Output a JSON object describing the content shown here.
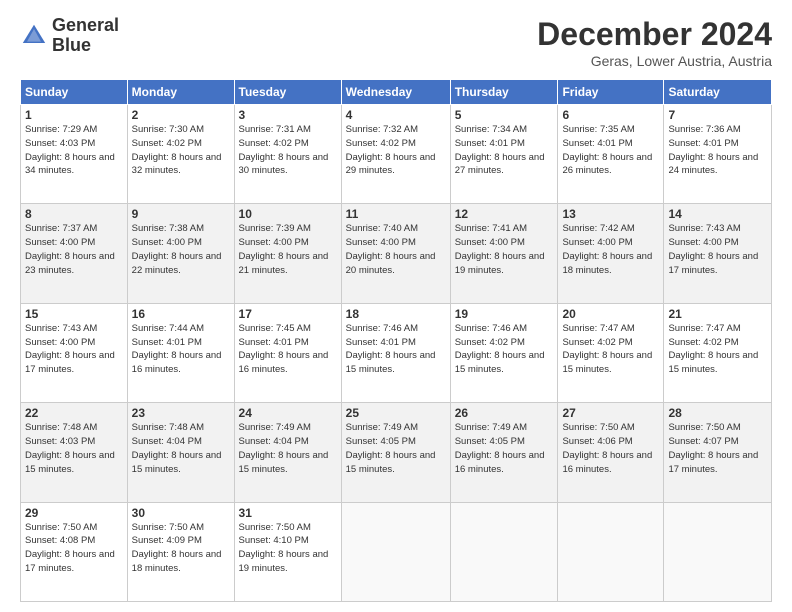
{
  "logo": {
    "line1": "General",
    "line2": "Blue"
  },
  "title": "December 2024",
  "location": "Geras, Lower Austria, Austria",
  "days_of_week": [
    "Sunday",
    "Monday",
    "Tuesday",
    "Wednesday",
    "Thursday",
    "Friday",
    "Saturday"
  ],
  "weeks": [
    [
      {
        "day": "1",
        "sunrise": "7:29 AM",
        "sunset": "4:03 PM",
        "daylight": "8 hours and 34 minutes."
      },
      {
        "day": "2",
        "sunrise": "7:30 AM",
        "sunset": "4:02 PM",
        "daylight": "8 hours and 32 minutes."
      },
      {
        "day": "3",
        "sunrise": "7:31 AM",
        "sunset": "4:02 PM",
        "daylight": "8 hours and 30 minutes."
      },
      {
        "day": "4",
        "sunrise": "7:32 AM",
        "sunset": "4:02 PM",
        "daylight": "8 hours and 29 minutes."
      },
      {
        "day": "5",
        "sunrise": "7:34 AM",
        "sunset": "4:01 PM",
        "daylight": "8 hours and 27 minutes."
      },
      {
        "day": "6",
        "sunrise": "7:35 AM",
        "sunset": "4:01 PM",
        "daylight": "8 hours and 26 minutes."
      },
      {
        "day": "7",
        "sunrise": "7:36 AM",
        "sunset": "4:01 PM",
        "daylight": "8 hours and 24 minutes."
      }
    ],
    [
      {
        "day": "8",
        "sunrise": "7:37 AM",
        "sunset": "4:00 PM",
        "daylight": "8 hours and 23 minutes."
      },
      {
        "day": "9",
        "sunrise": "7:38 AM",
        "sunset": "4:00 PM",
        "daylight": "8 hours and 22 minutes."
      },
      {
        "day": "10",
        "sunrise": "7:39 AM",
        "sunset": "4:00 PM",
        "daylight": "8 hours and 21 minutes."
      },
      {
        "day": "11",
        "sunrise": "7:40 AM",
        "sunset": "4:00 PM",
        "daylight": "8 hours and 20 minutes."
      },
      {
        "day": "12",
        "sunrise": "7:41 AM",
        "sunset": "4:00 PM",
        "daylight": "8 hours and 19 minutes."
      },
      {
        "day": "13",
        "sunrise": "7:42 AM",
        "sunset": "4:00 PM",
        "daylight": "8 hours and 18 minutes."
      },
      {
        "day": "14",
        "sunrise": "7:43 AM",
        "sunset": "4:00 PM",
        "daylight": "8 hours and 17 minutes."
      }
    ],
    [
      {
        "day": "15",
        "sunrise": "7:43 AM",
        "sunset": "4:00 PM",
        "daylight": "8 hours and 17 minutes."
      },
      {
        "day": "16",
        "sunrise": "7:44 AM",
        "sunset": "4:01 PM",
        "daylight": "8 hours and 16 minutes."
      },
      {
        "day": "17",
        "sunrise": "7:45 AM",
        "sunset": "4:01 PM",
        "daylight": "8 hours and 16 minutes."
      },
      {
        "day": "18",
        "sunrise": "7:46 AM",
        "sunset": "4:01 PM",
        "daylight": "8 hours and 15 minutes."
      },
      {
        "day": "19",
        "sunrise": "7:46 AM",
        "sunset": "4:02 PM",
        "daylight": "8 hours and 15 minutes."
      },
      {
        "day": "20",
        "sunrise": "7:47 AM",
        "sunset": "4:02 PM",
        "daylight": "8 hours and 15 minutes."
      },
      {
        "day": "21",
        "sunrise": "7:47 AM",
        "sunset": "4:02 PM",
        "daylight": "8 hours and 15 minutes."
      }
    ],
    [
      {
        "day": "22",
        "sunrise": "7:48 AM",
        "sunset": "4:03 PM",
        "daylight": "8 hours and 15 minutes."
      },
      {
        "day": "23",
        "sunrise": "7:48 AM",
        "sunset": "4:04 PM",
        "daylight": "8 hours and 15 minutes."
      },
      {
        "day": "24",
        "sunrise": "7:49 AM",
        "sunset": "4:04 PM",
        "daylight": "8 hours and 15 minutes."
      },
      {
        "day": "25",
        "sunrise": "7:49 AM",
        "sunset": "4:05 PM",
        "daylight": "8 hours and 15 minutes."
      },
      {
        "day": "26",
        "sunrise": "7:49 AM",
        "sunset": "4:05 PM",
        "daylight": "8 hours and 16 minutes."
      },
      {
        "day": "27",
        "sunrise": "7:50 AM",
        "sunset": "4:06 PM",
        "daylight": "8 hours and 16 minutes."
      },
      {
        "day": "28",
        "sunrise": "7:50 AM",
        "sunset": "4:07 PM",
        "daylight": "8 hours and 17 minutes."
      }
    ],
    [
      {
        "day": "29",
        "sunrise": "7:50 AM",
        "sunset": "4:08 PM",
        "daylight": "8 hours and 17 minutes."
      },
      {
        "day": "30",
        "sunrise": "7:50 AM",
        "sunset": "4:09 PM",
        "daylight": "8 hours and 18 minutes."
      },
      {
        "day": "31",
        "sunrise": "7:50 AM",
        "sunset": "4:10 PM",
        "daylight": "8 hours and 19 minutes."
      },
      null,
      null,
      null,
      null
    ]
  ]
}
